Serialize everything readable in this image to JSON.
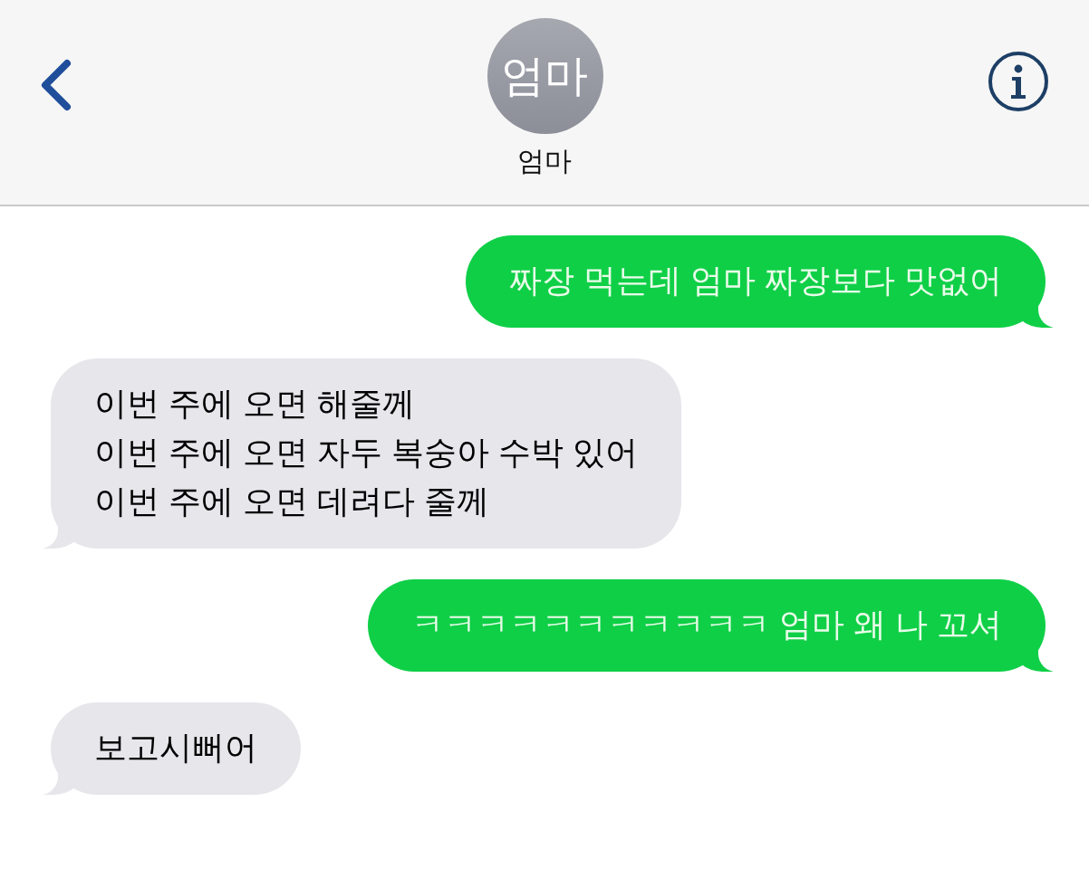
{
  "header": {
    "avatar_initials": "엄마",
    "contact_name": "엄마"
  },
  "messages": [
    {
      "kind": "sent",
      "text": "짜장 먹는데 엄마 짜장보다 맛없어"
    },
    {
      "kind": "received",
      "text": "이번 주에 오면 해줄께\n이번 주에 오면 자두 복숭아 수박 있어\n이번 주에 오면 데려다 줄께"
    },
    {
      "kind": "sent",
      "text": "ㅋㅋㅋㅋㅋㅋㅋㅋㅋㅋㅋ 엄마 왜 나 꼬셔"
    },
    {
      "kind": "received",
      "text": "보고시뻐어"
    }
  ]
}
